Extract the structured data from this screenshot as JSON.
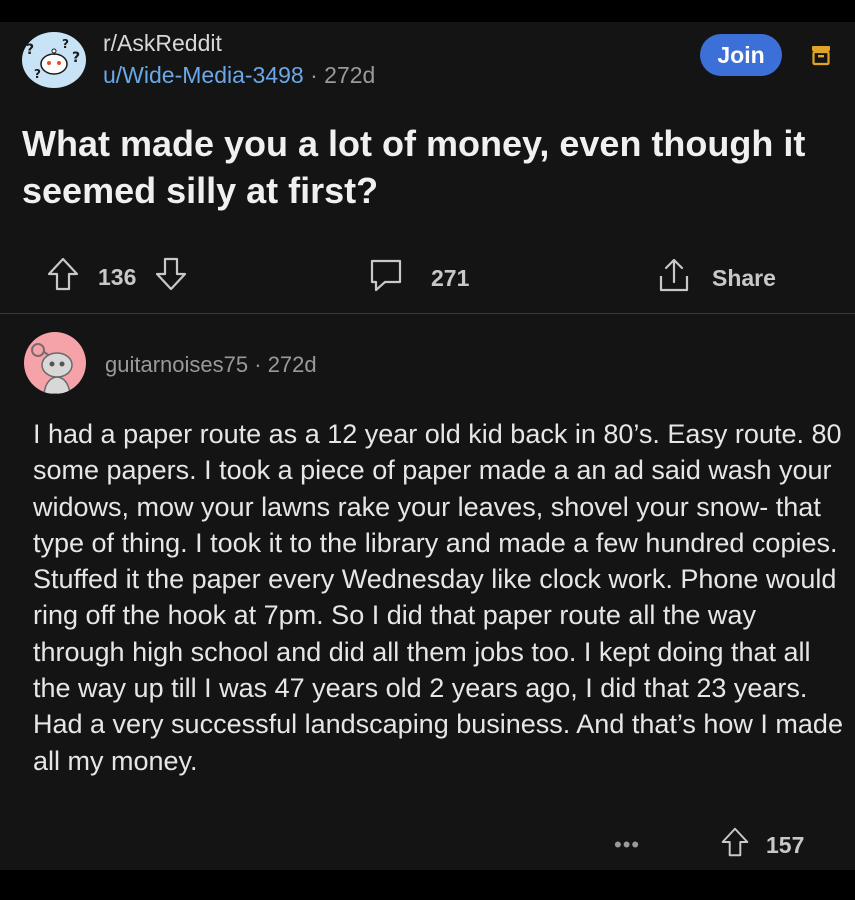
{
  "post": {
    "subreddit": "r/AskReddit",
    "author": "u/Wide-Media-3498",
    "separator": "·",
    "age": "272d",
    "join_label": "Join",
    "title": "What made you a lot of money, even though it seemed silly at first?",
    "upvotes": "136",
    "comments": "271",
    "share_label": "Share"
  },
  "comment": {
    "author": "guitarnoises75",
    "separator": "·",
    "age": "272d",
    "body": "I had a paper route as a 12 year old kid back in 80’s. Easy route. 80 some papers. I took a piece of paper made a an ad said wash your widows, mow your lawns rake your leaves, shovel your snow- that type of thing. I took it to the library and made a few hundred copies. Stuffed it the paper every Wednesday like clock work. Phone would ring off the hook at 7pm. So I did that paper route all the way through high school and did all them jobs too. I kept doing that all the way up till I was 47 years old 2 years ago, I did that 23 years. Had a very successful landscaping business. And that’s how I made all my money.",
    "more_label": "•••",
    "upvotes": "157"
  },
  "colors": {
    "background": "#141414",
    "accent": "#3d6fd8",
    "link": "#6aa8e8",
    "save_icon": "#e0a526",
    "comment_avatar": "#f5a3a8"
  },
  "icons": [
    "subreddit-avatar-icon",
    "save-icon",
    "upvote-icon",
    "downvote-icon",
    "comment-icon",
    "share-icon",
    "snoo-avatar-icon",
    "more-icon"
  ]
}
